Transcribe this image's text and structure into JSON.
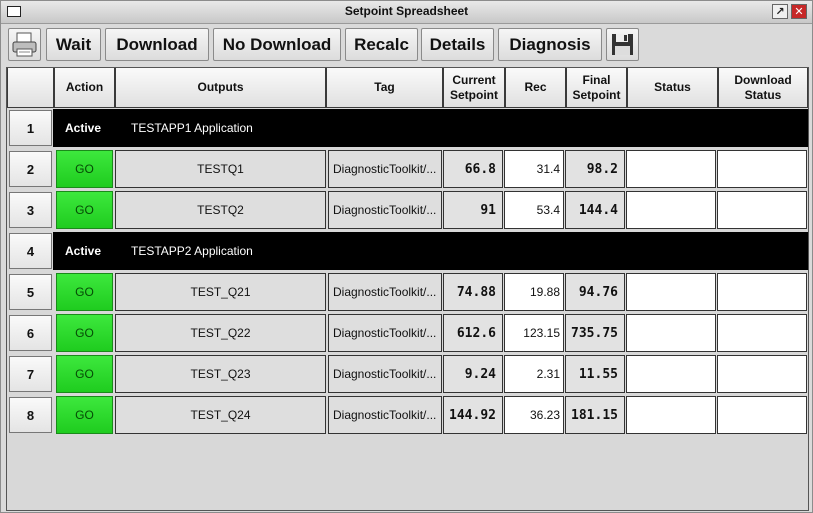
{
  "window": {
    "title": "Setpoint Spreadsheet"
  },
  "titlebar_buttons": {
    "restore": "↗",
    "close": "✕"
  },
  "toolbar": {
    "print_icon": "printer-icon",
    "wait": "Wait",
    "download": "Download",
    "no_download": "No Download",
    "recalc": "Recalc",
    "details": "Details",
    "diagnosis": "Diagnosis",
    "save_icon": "floppy-disk-icon"
  },
  "columns": [
    "",
    "Action",
    "Outputs",
    "Tag",
    "Current Setpoint",
    "Rec",
    "Final Setpoint",
    "Status",
    "Download Status"
  ],
  "rows": [
    {
      "num": "1",
      "type": "group",
      "action": "Active",
      "label": "TESTAPP1 Application"
    },
    {
      "num": "2",
      "type": "data",
      "action": "GO",
      "output": "TESTQ1",
      "tag": "DiagnosticToolkit/...",
      "current": "66.8",
      "rec": "31.4",
      "final": "98.2",
      "status": "",
      "download_status": ""
    },
    {
      "num": "3",
      "type": "data",
      "action": "GO",
      "output": "TESTQ2",
      "tag": "DiagnosticToolkit/...",
      "current": "91",
      "rec": "53.4",
      "final": "144.4",
      "status": "",
      "download_status": ""
    },
    {
      "num": "4",
      "type": "group",
      "action": "Active",
      "label": "TESTAPP2 Application"
    },
    {
      "num": "5",
      "type": "data",
      "action": "GO",
      "output": "TEST_Q21",
      "tag": "DiagnosticToolkit/...",
      "current": "74.88",
      "rec": "19.88",
      "final": "94.76",
      "status": "",
      "download_status": ""
    },
    {
      "num": "6",
      "type": "data",
      "action": "GO",
      "output": "TEST_Q22",
      "tag": "DiagnosticToolkit/...",
      "current": "612.6",
      "rec": "123.15",
      "final": "735.75",
      "status": "",
      "download_status": ""
    },
    {
      "num": "7",
      "type": "data",
      "action": "GO",
      "output": "TEST_Q23",
      "tag": "DiagnosticToolkit/...",
      "current": "9.24",
      "rec": "2.31",
      "final": "11.55",
      "status": "",
      "download_status": ""
    },
    {
      "num": "8",
      "type": "data",
      "action": "GO",
      "output": "TEST_Q24",
      "tag": "DiagnosticToolkit/...",
      "current": "144.92",
      "rec": "36.23",
      "final": "181.15",
      "status": "",
      "download_status": ""
    }
  ],
  "colors": {
    "go_green": "#2ad82a",
    "group_bg": "#000000"
  }
}
